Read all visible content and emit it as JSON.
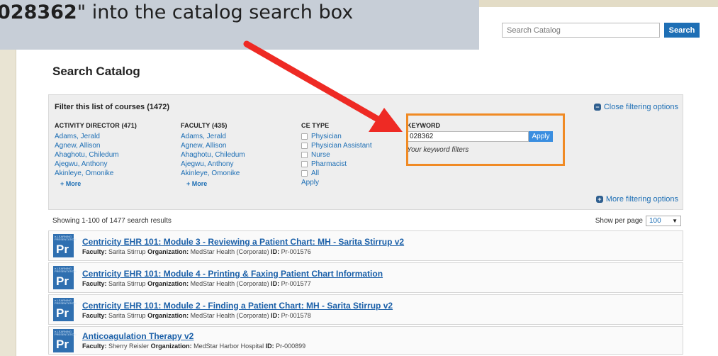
{
  "callout": {
    "bold": "028362",
    "rest": "\" into the catalog search box"
  },
  "top_search": {
    "placeholder": "Search Catalog",
    "button": "Search"
  },
  "page_title": "Search Catalog",
  "filter": {
    "title": "Filter this list of courses (1472)",
    "close": "Close filtering options",
    "more": "More filtering options",
    "activity_director": {
      "header": "ACTIVITY DIRECTOR (471)",
      "items": [
        "Adams, Jerald",
        "Agnew, Allison",
        "Ahaghotu, Chiledum",
        "Ajegwu, Anthony",
        "Akinleye, Omonike"
      ],
      "more": "+ More"
    },
    "faculty": {
      "header": "FACULTY (435)",
      "items": [
        "Adams, Jerald",
        "Agnew, Allison",
        "Ahaghotu, Chiledum",
        "Ajegwu, Anthony",
        "Akinleye, Omonike"
      ],
      "more": "+ More"
    },
    "ce_type": {
      "header": "CE TYPE",
      "items": [
        "Physician",
        "Physician Assistant",
        "Nurse",
        "Pharmacist",
        "All"
      ],
      "apply": "Apply"
    },
    "keyword": {
      "header": "KEYWORD",
      "value": "028362",
      "apply": "Apply",
      "note": "Your keyword filters"
    }
  },
  "results_summary": "Showing 1-100 of 1477 search results",
  "per_page": {
    "label": "Show per page",
    "value": "100"
  },
  "results": [
    {
      "title": "Centricity EHR 101: Module 3 - Reviewing a Patient Chart: MH - Sarita Stirrup v2",
      "faculty": "Sarita Stirrup",
      "organization": "MedStar Health (Corporate)",
      "id": "Pr-001576"
    },
    {
      "title": "Centricity EHR 101: Module 4 - Printing & Faxing Patient Chart Information",
      "faculty": "Sarita Stirrup",
      "organization": "MedStar Health (Corporate)",
      "id": "Pr-001577"
    },
    {
      "title": "Centricity EHR 101: Module 2 - Finding a Patient Chart: MH - Sarita Stirrup v2",
      "faculty": "Sarita Stirrup",
      "organization": "MedStar Health (Corporate)",
      "id": "Pr-001578"
    },
    {
      "title": "Anticoagulation Therapy v2",
      "faculty": "Sherry Reisler",
      "organization": "MedStar Harbor Hospital",
      "id": "Pr-000899"
    }
  ],
  "labels": {
    "faculty": "Faculty:",
    "organization": "Organization:",
    "id": "ID:"
  },
  "thumb": {
    "tiny": "e-LEARNING PRESENTATION",
    "badge": "Pr"
  },
  "colors": {
    "arrow": "#ee2a24",
    "highlight_box": "#f08a24",
    "accent": "#1e6fb5"
  }
}
